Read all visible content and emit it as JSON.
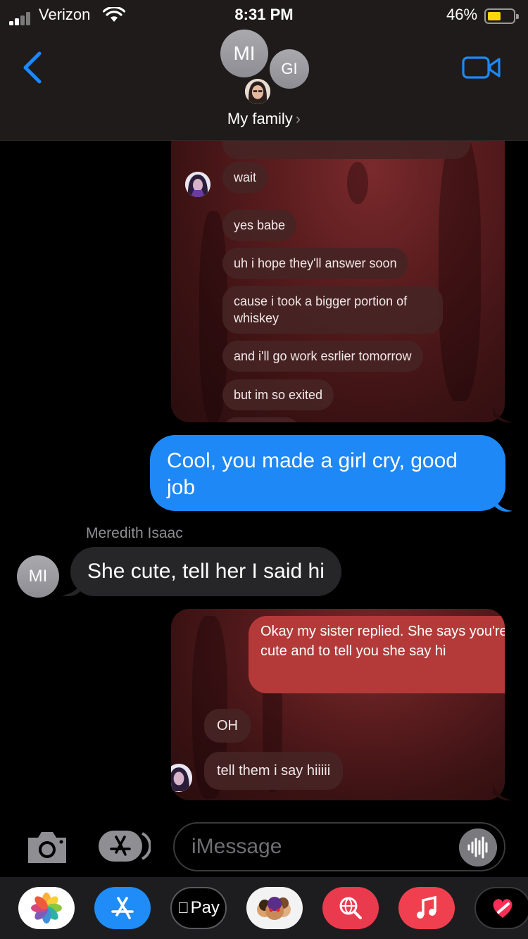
{
  "status_bar": {
    "carrier": "Verizon",
    "time": "8:31 PM",
    "battery_percent": "46%",
    "battery_level": 0.46,
    "battery_color": "#ffd60a"
  },
  "header": {
    "avatars": [
      "MI",
      "GI"
    ],
    "group_name": "My family",
    "chevron": "›",
    "back_icon": "chevron-left-icon",
    "video_icon": "video-camera-icon",
    "accent": "#1e88f6"
  },
  "screenshot_top": {
    "messages": [
      "wait",
      "wait",
      "yes babe",
      "uh i hope they'll answer soon",
      "cause i took a bigger portion of whiskey",
      "and i'll go work esrlier tomorrow",
      "but im so exited"
    ]
  },
  "thread": {
    "sent_message": "Cool, you made a girl cry, good job",
    "sender_name": "Meredith Isaac",
    "sender_initials": "MI",
    "received_message": "She cute, tell her I said hi"
  },
  "screenshot_bottom": {
    "self_message": "Okay my sister replied. She says you're cute and to tell you she say hi",
    "messages": [
      "OH",
      "tell them i say hiiiii"
    ]
  },
  "input_bar": {
    "placeholder": "iMessage",
    "camera_icon": "camera-icon",
    "apps_icon": "app-store-icon",
    "audio_icon": "audio-waveform-icon"
  },
  "app_drawer": {
    "apps": [
      "photos-icon",
      "app-store-icon",
      "Pay",
      "memoji-stickers-icon",
      "image-search-icon",
      "music-icon",
      "digital-touch-icon"
    ]
  }
}
